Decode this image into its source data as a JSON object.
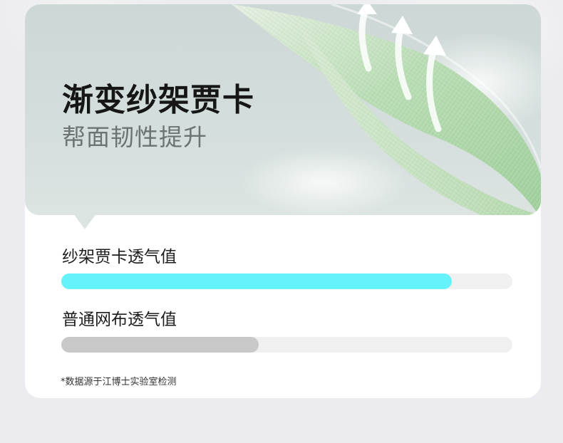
{
  "hero": {
    "title": "渐变纱架贾卡",
    "subtitle": "帮面韧性提升"
  },
  "metrics": [
    {
      "label": "纱架贾卡透气值",
      "level_percent": 86.6,
      "fill_color": "#66f2f9"
    },
    {
      "label": "普通网布透气值",
      "level_percent": 43.7,
      "fill_color": "#c8c8c8"
    }
  ],
  "footnote": "*数据源于江博士实验室检测",
  "colors": {
    "page_background": "#ecebf0",
    "hero_background": "#d4dedc",
    "mesh_green": "#a9d3a6",
    "track": "#f0f0f0"
  },
  "icons": [
    "airflow-arrow-icon",
    "airflow-arrow-icon",
    "airflow-arrow-icon"
  ]
}
